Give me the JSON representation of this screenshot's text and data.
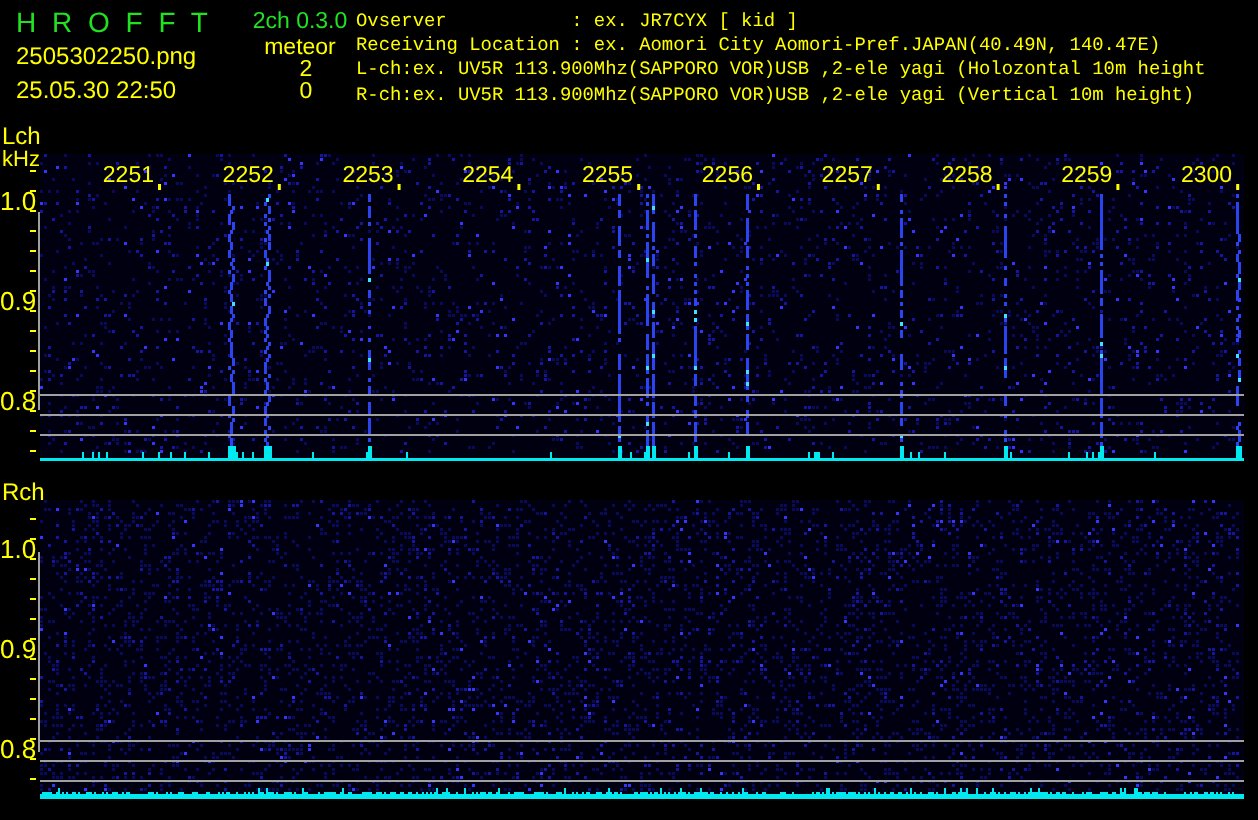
{
  "header": {
    "app_title": "H R O F F T",
    "filename": "2505302250.png",
    "datetime": "25.05.30 22:50",
    "version": "2ch 0.3.0",
    "meteor_label": "meteor",
    "meteor_counts": [
      "2",
      "0"
    ],
    "info_lines": [
      "Ovserver           : ex. JR7CYX [ kid ]",
      "Receiving Location : ex. Aomori City Aomori-Pref.JAPAN(40.49N, 140.47E)",
      "L-ch:ex. UV5R 113.900Mhz(SAPPORO VOR)USB ,2-ele yagi (Holozontal 10m height",
      "R-ch:ex. UV5R 113.900Mhz(SAPPORO VOR)USB ,2-ele yagi (Vertical 10m height)"
    ]
  },
  "panels": [
    {
      "kind": "streaks",
      "channel": "Lch",
      "unit": "kHz",
      "x_ticks": [
        "2251",
        "2252",
        "2253",
        "2254",
        "2255",
        "2256",
        "2257",
        "2258",
        "2259",
        "2300"
      ],
      "y_ticks": [
        "1.0",
        "0.9",
        "0.8"
      ]
    },
    {
      "kind": "noise",
      "channel": "Rch",
      "y_ticks": [
        "1.0",
        "0.9",
        "0.8"
      ]
    }
  ]
}
